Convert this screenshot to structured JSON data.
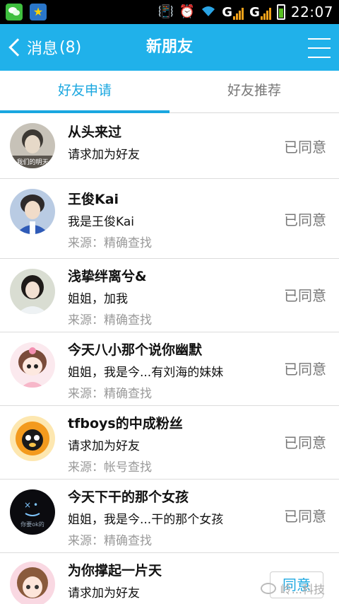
{
  "status_bar": {
    "time": "22:07",
    "network": "G"
  },
  "header": {
    "back_label": "消息",
    "back_count": "(8)",
    "title": "新朋友"
  },
  "tabs": [
    {
      "label": "好友申请",
      "active": true
    },
    {
      "label": "好友推荐",
      "active": false
    }
  ],
  "requests": [
    {
      "name": "从头来过",
      "message": "请求加为好友",
      "source": "",
      "status": "已同意",
      "avatar_caption": "我们的明天"
    },
    {
      "name": "王俊Kai",
      "message": "我是王俊Kai",
      "source": "来源：精确查找",
      "status": "已同意"
    },
    {
      "name": "浅挚绊离兮&",
      "message": "姐姐，加我",
      "source": "来源：精确查找",
      "status": "已同意"
    },
    {
      "name": "今天八小那个说你幽默",
      "message": "姐姐，我是今...有刘海的妹妹",
      "source": "来源：精确查找",
      "status": "已同意"
    },
    {
      "name": "tfboys的中成粉丝",
      "message": "请求加为好友",
      "source": "来源：帐号查找",
      "status": "已同意"
    },
    {
      "name": "今天下干的那个女孩",
      "message": "姐姐，我是今...干的那个女孩",
      "source": "来源：精确查找",
      "status": "已同意",
      "avatar_caption": "你要ok的"
    },
    {
      "name": "为你撑起一片天",
      "message": "请求加为好友",
      "source": "",
      "status": "同意"
    }
  ],
  "watermark": "岭...科技",
  "colors": {
    "accent": "#20b1ea",
    "tab_active": "#1aa7e0"
  }
}
